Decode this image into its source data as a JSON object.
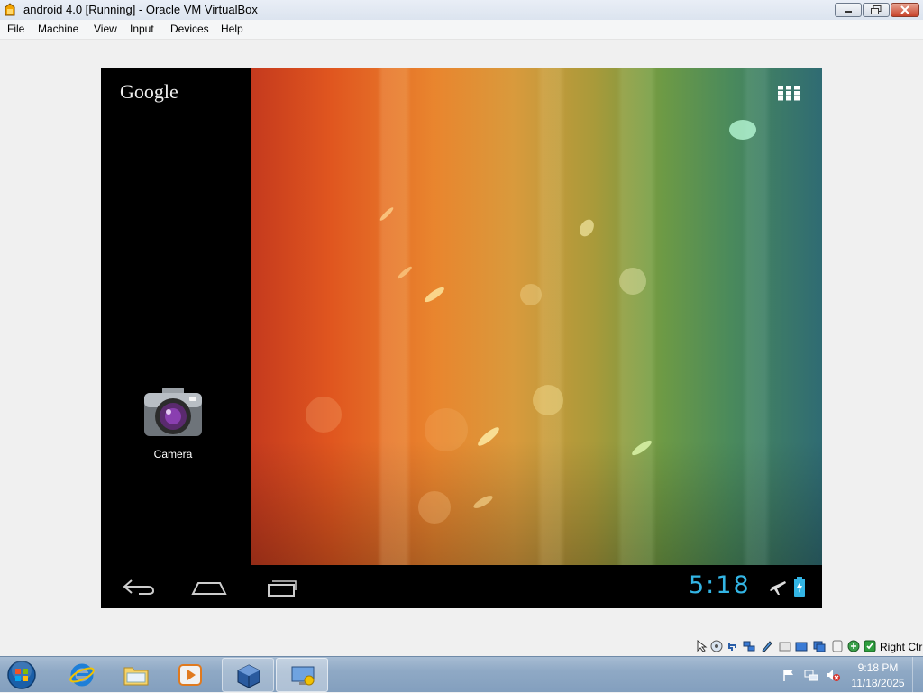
{
  "window": {
    "title": "android 4.0 [Running] - Oracle VM VirtualBox",
    "buttons": [
      "minimize-icon",
      "maximize-icon",
      "close-icon"
    ]
  },
  "menubar": {
    "items": [
      {
        "label": "File"
      },
      {
        "label": "Machine"
      },
      {
        "label": "View"
      },
      {
        "label": "Input"
      },
      {
        "label": "Devices"
      },
      {
        "label": "Help"
      }
    ]
  },
  "android": {
    "google_logo": "Google",
    "apps_icon": "all-apps-grid-icon",
    "shortcuts": [
      {
        "label": "Camera",
        "icon": "camera-icon"
      }
    ],
    "navbar": {
      "back": "back-icon",
      "home": "home-icon",
      "recents": "recent-apps-icon"
    },
    "clock": "5:18",
    "status_icons": [
      "airplane-mode-icon",
      "battery-charging-icon"
    ],
    "clock_color": "#33b5e5"
  },
  "vbox_status": {
    "icons": [
      "mouse-integration-icon",
      "optical-drive-icon",
      "usb-icon",
      "network-icon",
      "shared-folders-icon",
      "display-icon",
      "video-capture-icon",
      "hard-disk-icon",
      "cpu-icon",
      "keyboard-capture-icon",
      "seamless-icon"
    ],
    "host_key": "Right Ctrl"
  },
  "taskbar": {
    "apps": [
      "start-button",
      "internet-explorer-icon",
      "windows-explorer-icon",
      "media-player-icon",
      "virtualbox-icon",
      "vm-window-icon"
    ],
    "tray_icons": [
      "action-center-flag-icon",
      "network-icon",
      "volume-muted-icon"
    ],
    "time": "9:18 PM",
    "date": "11/18/2025"
  }
}
